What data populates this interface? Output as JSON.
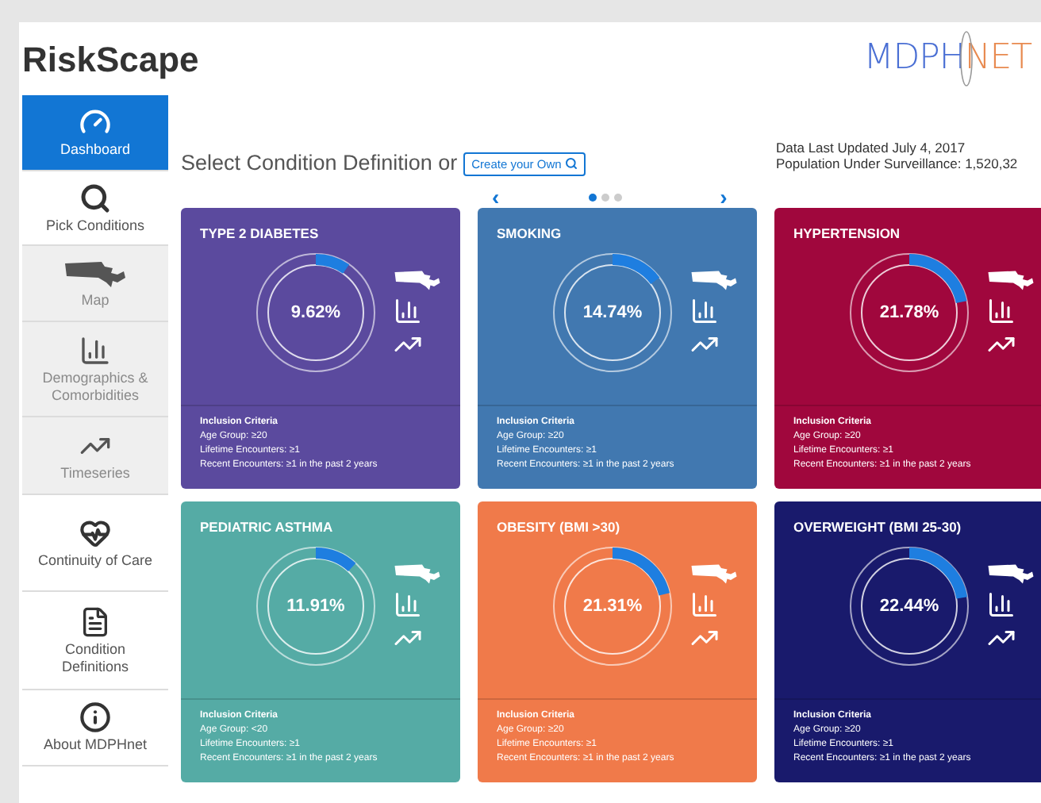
{
  "app_title": "RiskScape",
  "logo": {
    "part_1": "MDPH",
    "part_2": "NET"
  },
  "sidebar": {
    "items": [
      {
        "kind": "dashboard",
        "label": "Dashboard",
        "selected": true,
        "disabled": false
      },
      {
        "kind": "search",
        "label": "Pick Conditions",
        "selected": false,
        "disabled": false
      },
      {
        "kind": "map",
        "label": "Map",
        "selected": false,
        "disabled": true
      },
      {
        "kind": "bars",
        "label": "Demographics & Comorbidities",
        "selected": false,
        "disabled": true
      },
      {
        "kind": "trend",
        "label": "Timeseries",
        "selected": false,
        "disabled": true
      },
      {
        "kind": "heart",
        "label": "Continuity of Care",
        "selected": false,
        "disabled": false
      },
      {
        "kind": "document",
        "label": "Condition Definitions",
        "selected": false,
        "disabled": false
      },
      {
        "kind": "info",
        "label": "About MDPHnet",
        "selected": false,
        "disabled": false
      }
    ]
  },
  "prompt": "Select Condition Definition or",
  "create_button": "Create your Own",
  "data_info": [
    "Data Last Updated July 4, 2017",
    "Population Under Surveillance: 1,520,32"
  ],
  "carousel": {
    "prev": "‹",
    "next": "›",
    "pages": [
      {
        "selected": true
      },
      {
        "selected": false
      },
      {
        "selected": false
      }
    ]
  },
  "cards": [
    {
      "title": "TYPE 2 DIABETES",
      "value": "9.62%",
      "level": 0.0962,
      "color": "#5b4a9e",
      "criteria_title": "Inclusion Criteria",
      "criteria": [
        "Age Group: ≥20",
        "Lifetime Encounters: ≥1",
        "Recent Encounters: ≥1 in the past 2 years"
      ]
    },
    {
      "title": "SMOKING",
      "value": "14.74%",
      "level": 0.1474,
      "color": "#4178b0",
      "criteria_title": "Inclusion Criteria",
      "criteria": [
        "Age Group: ≥20",
        "Lifetime Encounters: ≥1",
        "Recent Encounters: ≥1 in the past 2 years"
      ]
    },
    {
      "title": "HYPERTENSION",
      "value": "21.78%",
      "level": 0.2178,
      "color": "#a0073d",
      "criteria_title": "Inclusion Criteria",
      "criteria": [
        "Age Group: ≥20",
        "Lifetime Encounters: ≥1",
        "Recent Encounters: ≥1 in the past 2 years"
      ]
    },
    {
      "title": "PEDIATRIC ASTHMA",
      "value": "11.91%",
      "level": 0.1191,
      "color": "#55aba5",
      "criteria_title": "Inclusion Criteria",
      "criteria": [
        "Age Group: <20",
        "Lifetime Encounters: ≥1",
        "Recent Encounters: ≥1 in the past 2 years"
      ]
    },
    {
      "title": "OBESITY (BMI >30)",
      "value": "21.31%",
      "level": 0.2131,
      "color": "#f07a4a",
      "criteria_title": "Inclusion Criteria",
      "criteria": [
        "Age Group: ≥20",
        "Lifetime Encounters: ≥1",
        "Recent Encounters: ≥1 in the past 2 years"
      ]
    },
    {
      "title": "OVERWEIGHT (BMI 25-30)",
      "value": "22.44%",
      "level": 0.2244,
      "color": "#191a6c",
      "criteria_title": "Inclusion Criteria",
      "criteria": [
        "Age Group: ≥20",
        "Lifetime Encounters: ≥1",
        "Recent Encounters: ≥1 in the past 2 years"
      ]
    }
  ]
}
